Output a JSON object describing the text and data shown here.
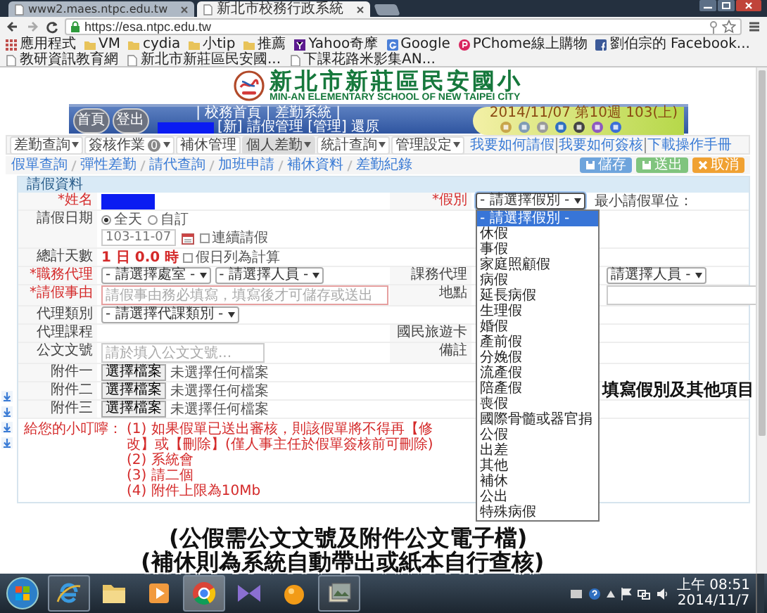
{
  "browser": {
    "tabs": [
      {
        "title": "www2.maes.ntpc.edu.tw",
        "selected": false
      },
      {
        "title": "新北市校務行政系統",
        "selected": true
      }
    ],
    "address": "https://esa.ntpc.edu.tw",
    "bookmarks": [
      {
        "kind": "apps",
        "label": "應用程式"
      },
      {
        "kind": "folder",
        "label": "VM"
      },
      {
        "kind": "folder",
        "label": "cydia"
      },
      {
        "kind": "folder",
        "label": "小tip"
      },
      {
        "kind": "folder",
        "label": "推薦"
      },
      {
        "kind": "yahoo",
        "label": "Yahoo奇摩"
      },
      {
        "kind": "google",
        "label": "Google"
      },
      {
        "kind": "pchome",
        "label": "PChome線上購物"
      },
      {
        "kind": "facebook",
        "label": "劉伯宗的 Facebook..."
      },
      {
        "kind": "page",
        "label": "教研資訊教育網"
      },
      {
        "kind": "page",
        "label": "新北市新莊區民安國..."
      },
      {
        "kind": "page",
        "label": "下課花路米影集AN..."
      }
    ]
  },
  "site": {
    "school_name": "新北市新莊區民安國小",
    "school_name_en": "MIN-AN ELEMENTARY SCHOOL OF NEW TAIPEI CITY",
    "round_buttons": [
      "首頁",
      "登出"
    ],
    "top_links": "| 校務首頁 | 差勤系統 |",
    "user_line": "[新] 請假管理 [管理] 還原",
    "date_line": "2014/11/07 第10週 103(上)"
  },
  "nav": {
    "menus": [
      {
        "label": "差勤查詢",
        "dropdown": true,
        "selected": false
      },
      {
        "label": "簽核作業",
        "badge": "0",
        "dropdown": true,
        "selected": false
      },
      {
        "label": "補休管理",
        "dropdown": false,
        "selected": false
      },
      {
        "label": "個人差勤",
        "dropdown": true,
        "selected": true
      },
      {
        "label": "統計查詢",
        "dropdown": true,
        "selected": false
      },
      {
        "label": "管理設定",
        "dropdown": true,
        "selected": false
      }
    ],
    "help_links": [
      "我要如何請假",
      "我要如何簽核",
      "下載操作手冊"
    ]
  },
  "breadcrumb": [
    "假單查詢",
    "彈性差勤",
    "請代查詢",
    "加班申請",
    "補休資料",
    "差勤紀錄"
  ],
  "actions": [
    {
      "kind": "save",
      "label": "儲存"
    },
    {
      "kind": "submit",
      "label": "送出"
    },
    {
      "kind": "cancel",
      "label": "取消"
    }
  ],
  "form": {
    "title": "請假資料",
    "rows": [
      {
        "left": {
          "label": "*姓名",
          "required": true,
          "kind": "redacted"
        },
        "right": {
          "label": "*假別",
          "required": true,
          "kind": "select_open",
          "value": "- 請選擇假別 -",
          "note": "最小請假單位："
        }
      },
      {
        "left": {
          "label": "請假日期",
          "required": false,
          "kind": "date",
          "options": [
            {
              "label": "全天",
              "selected": true
            },
            {
              "label": "自訂",
              "selected": false
            }
          ],
          "date": "103-11-07",
          "checkbox": {
            "label": "連續請假",
            "checked": false
          }
        }
      },
      {
        "left": {
          "label": "總計天數",
          "required": false,
          "kind": "total",
          "value": "1 日 0.0 時",
          "checkbox": {
            "label": "假日列為計算",
            "checked": false
          }
        }
      },
      {
        "left": {
          "label": "*職務代理",
          "required": true,
          "kind": "selects",
          "selects": [
            "- 請選擇處室 -",
            "- 請選擇人員 -"
          ]
        },
        "right": {
          "label": "課務代理",
          "required": false,
          "kind": "selects",
          "selects": [
            "請選擇人員 -"
          ]
        }
      },
      {
        "left": {
          "label": "*請假事由",
          "required": true,
          "kind": "input",
          "placeholder": "請假事由務必填寫，填寫後才可儲存或送出"
        },
        "right": {
          "label": "地點",
          "required": false,
          "kind": "input"
        }
      },
      {
        "left": {
          "label": "代理類別",
          "required": false,
          "kind": "selects",
          "selects": [
            "- 請選擇代課類別 -"
          ]
        }
      },
      {
        "left": {
          "label": "代理課程",
          "required": false,
          "kind": "empty"
        },
        "right": {
          "label": "國民旅遊卡",
          "required": false,
          "kind": "empty"
        }
      },
      {
        "left": {
          "label": "公文文號",
          "required": false,
          "kind": "input",
          "placeholder": "請於填入公文文號..."
        },
        "right": {
          "label": "備註",
          "required": false,
          "kind": "empty"
        }
      },
      {
        "left": {
          "label": "附件一",
          "required": false,
          "kind": "file",
          "button": "選擇檔案",
          "status": "未選擇任何檔案"
        }
      },
      {
        "left": {
          "label": "附件二",
          "required": false,
          "kind": "file",
          "button": "選擇檔案",
          "status": "未選擇任何檔案"
        }
      },
      {
        "left": {
          "label": "附件三",
          "required": false,
          "kind": "file",
          "button": "選擇檔案",
          "status": "未選擇任何檔案"
        }
      }
    ]
  },
  "dropdown": {
    "options": [
      {
        "label": "- 請選擇假別 -",
        "selected": true
      },
      {
        "label": "休假",
        "selected": false
      },
      {
        "label": "事假",
        "selected": false
      },
      {
        "label": "家庭照顧假",
        "selected": false
      },
      {
        "label": "病假",
        "selected": false
      },
      {
        "label": "延長病假",
        "selected": false
      },
      {
        "label": "生理假",
        "selected": false
      },
      {
        "label": "婚假",
        "selected": false
      },
      {
        "label": "產前假",
        "selected": false
      },
      {
        "label": "分娩假",
        "selected": false
      },
      {
        "label": "流產假",
        "selected": false
      },
      {
        "label": "陪產假",
        "selected": false
      },
      {
        "label": "喪假",
        "selected": false
      },
      {
        "label": "國際骨髓或器官捐",
        "selected": false
      },
      {
        "label": "公假",
        "selected": false
      },
      {
        "label": "出差",
        "selected": false
      },
      {
        "label": "其他",
        "selected": false
      },
      {
        "label": "補休",
        "selected": false
      },
      {
        "label": "公出",
        "selected": false
      },
      {
        "label": "特殊病假",
        "selected": false
      }
    ]
  },
  "notes": {
    "label": "給您的小叮嚀：",
    "items": [
      "(1) 如果假單已送出審核，則該假單將不得再【修改】或【刪除】(僅人事主任於假單簽核前可刪除)",
      "(2) 系統會",
      "(3) 請二個",
      "(4) 附件上限為10Mb"
    ]
  },
  "annotations": [
    "填寫假別及其他項目",
    "(公假需公文文號及附件公文電子檔)",
    "(補休則為系統自動帶出或紙本自行查核)"
  ],
  "taskbar": {
    "apps": [
      {
        "kind": "ie",
        "running": true,
        "selected": false
      },
      {
        "kind": "folder",
        "running": false,
        "selected": false
      },
      {
        "kind": "media",
        "running": false,
        "selected": false
      },
      {
        "kind": "chrome",
        "running": true,
        "selected": true
      },
      {
        "kind": "studio",
        "running": false,
        "selected": false
      },
      {
        "kind": "orange",
        "running": false,
        "selected": false
      },
      {
        "kind": "gallery",
        "running": true,
        "selected": false
      }
    ],
    "time": "上午 08:51",
    "date": "2014/11/7"
  }
}
